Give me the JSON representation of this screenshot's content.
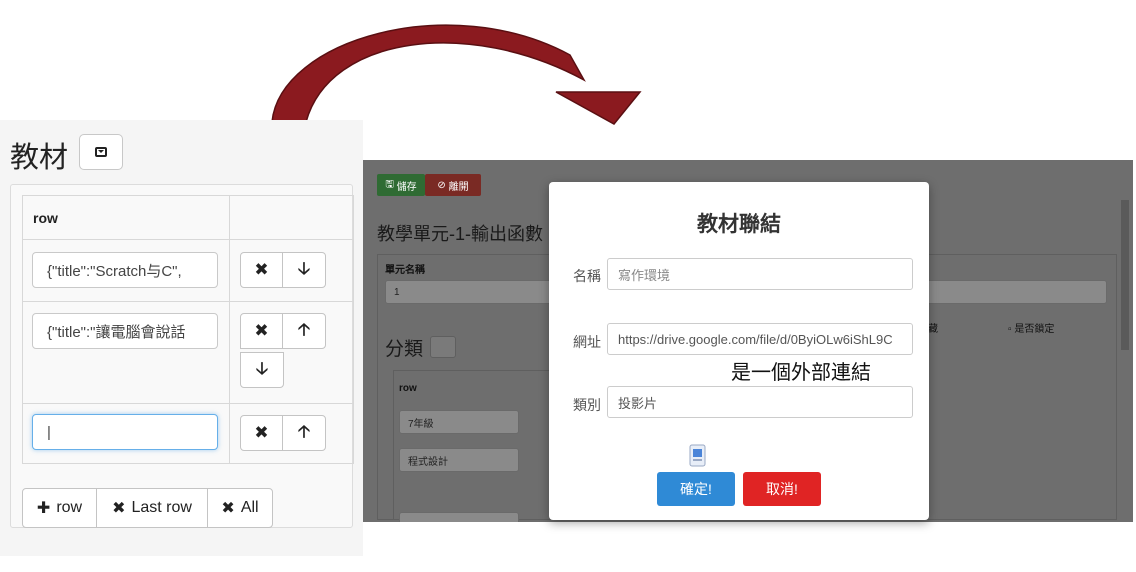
{
  "left": {
    "title": "教材",
    "header": "row",
    "rows": [
      {
        "value": "{\"title\":\"Scratch与C\","
      },
      {
        "value": "{\"title\":\"讓電腦會說話"
      },
      {
        "value": "|"
      }
    ],
    "buttons": {
      "add_row": "row",
      "last_row": "Last row",
      "all": "All"
    }
  },
  "behind": {
    "save": "儲存",
    "leave": "離開",
    "unit_title": "教學單元-1-輸出函數",
    "unit_name_label": "單元名稱",
    "unit_name_value": "1",
    "category_title": "分類",
    "category_header": "row",
    "category_rows": [
      "7年級",
      "程式設計"
    ],
    "hidden_label": "藏",
    "lock_label": "是否鎖定"
  },
  "modal": {
    "title": "教材聯結",
    "name_label": "名稱",
    "name_placeholder": "寫作環境",
    "url_label": "網址",
    "url_value": "https://drive.google.com/file/d/0ByiOLw6iShL9C",
    "type_label": "類別",
    "type_value": "投影片",
    "confirm": "確定!",
    "cancel": "取消!"
  },
  "annotation": "是一個外部連結",
  "colors": {
    "arrow": "#8b1a1f",
    "confirm": "#2f8ad6",
    "cancel": "#e02424",
    "save": "#3b9a40",
    "leave": "#c0392b"
  }
}
